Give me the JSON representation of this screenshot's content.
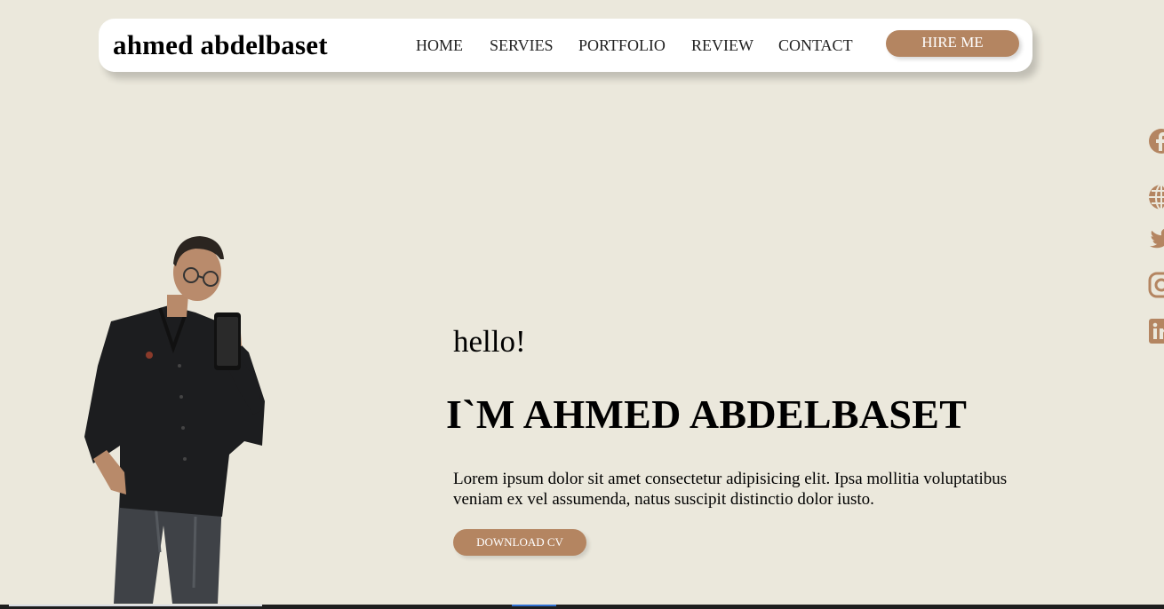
{
  "brand": "ahmed abdelbaset",
  "nav": {
    "items": [
      {
        "label": "HOME"
      },
      {
        "label": "SERVIES"
      },
      {
        "label": "PORTFOLIO"
      },
      {
        "label": "REVIEW"
      },
      {
        "label": "CONTACT"
      }
    ],
    "hire_label": "HIRE ME"
  },
  "hero": {
    "greeting": "hello!",
    "headline": "I`M AHMED ABDELBASET",
    "description": "Lorem ipsum dolor sit amet consectetur adipisicing elit. Ipsa mollitia voluptatibus veniam ex vel assumenda, natus suscipit distinctio dolor iusto.",
    "cv_label": "DOWNLOAD CV"
  },
  "social": [
    "facebook-icon",
    "globe-icon",
    "twitter-icon",
    "instagram-icon",
    "linkedin-icon"
  ],
  "colors": {
    "background": "#ebe8dc",
    "accent": "#b48561",
    "navbar": "#ffffff"
  }
}
